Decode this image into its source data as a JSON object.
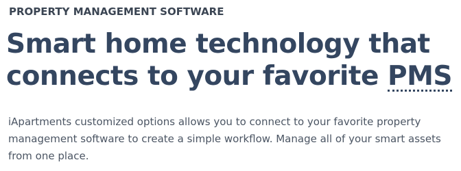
{
  "hero": {
    "eyebrow": "PROPERTY MANAGEMENT SOFTWARE",
    "headline_line1": "Smart home technology that",
    "headline_line2_prefix": "connects to your favorite ",
    "headline_abbr": "PMS",
    "body": "iApartments customized options allows you to connect to your favorite property management software to create a simple workflow. Manage all of your smart assets from one place."
  }
}
